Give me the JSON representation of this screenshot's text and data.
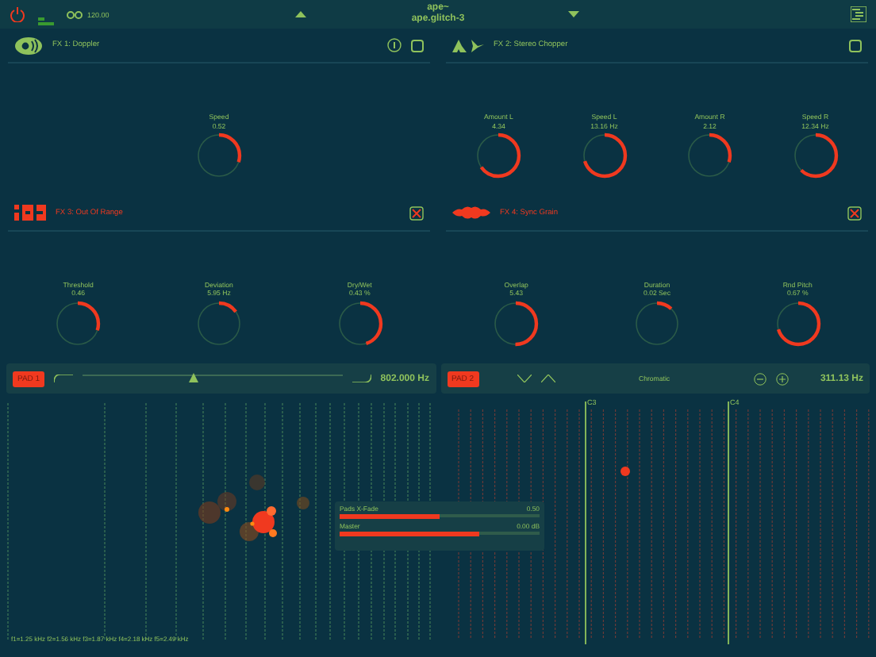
{
  "top_bar": {
    "tempo": "120.00",
    "title": "ape~",
    "subtitle": "ape.glitch-3"
  },
  "effects": [
    {
      "label": "FX 1: Doppler",
      "kind": "doppler",
      "active": true,
      "info": true,
      "knobs": [
        {
          "name": "Speed",
          "reading": "0.52",
          "level": 0.3
        }
      ]
    },
    {
      "label": "FX 2: Stereo Chopper",
      "kind": "chopper",
      "active": true,
      "info": false,
      "knobs": [
        {
          "name": "Amount L",
          "reading": "4.34",
          "level": 0.65
        },
        {
          "name": "Speed L",
          "reading": "13.16 Hz",
          "level": 0.7
        },
        {
          "name": "Amount R",
          "reading": "2.12",
          "level": 0.3
        },
        {
          "name": "Speed R",
          "reading": "12.34 Hz",
          "level": 0.62
        }
      ]
    },
    {
      "label": "FX 3: Out Of Range",
      "kind": "range",
      "active": false,
      "info": false,
      "knobs": [
        {
          "name": "Threshold",
          "reading": "0.46",
          "level": 0.3
        },
        {
          "name": "Deviation",
          "reading": "5.95 Hz",
          "level": 0.15
        },
        {
          "name": "Dry/Wet",
          "reading": "0.43 %",
          "level": 0.45
        }
      ]
    },
    {
      "label": "FX 4: Sync Grain",
      "kind": "grain",
      "active": false,
      "info": false,
      "knobs": [
        {
          "name": "Overlap",
          "reading": "5.43",
          "level": 0.5
        },
        {
          "name": "Duration",
          "reading": "0.02 Sec",
          "level": 0.12
        },
        {
          "name": "Rnd Pitch",
          "reading": "0.67 %",
          "level": 0.7
        }
      ]
    }
  ],
  "pad_bars": [
    {
      "kind": "filter",
      "pad": "PAD 1",
      "level": 0.43,
      "reading": "802.000 Hz"
    },
    {
      "kind": "scale",
      "pad": "PAD 2",
      "scale": "Chromatic",
      "reading": "311.13 Hz"
    }
  ],
  "note_labels": [
    "C3",
    "C4"
  ],
  "mixer": [
    {
      "name": "Pads X-Fade",
      "reading": "0.50",
      "level": 0.5
    },
    {
      "name": "Master",
      "reading": "0.00 dB",
      "level": 0.7
    }
  ],
  "status_bar": "f1=1.25 kHz f2=1.56 kHz f3=1.87 kHz f4=2.18 kHz f5=2.49 kHz"
}
